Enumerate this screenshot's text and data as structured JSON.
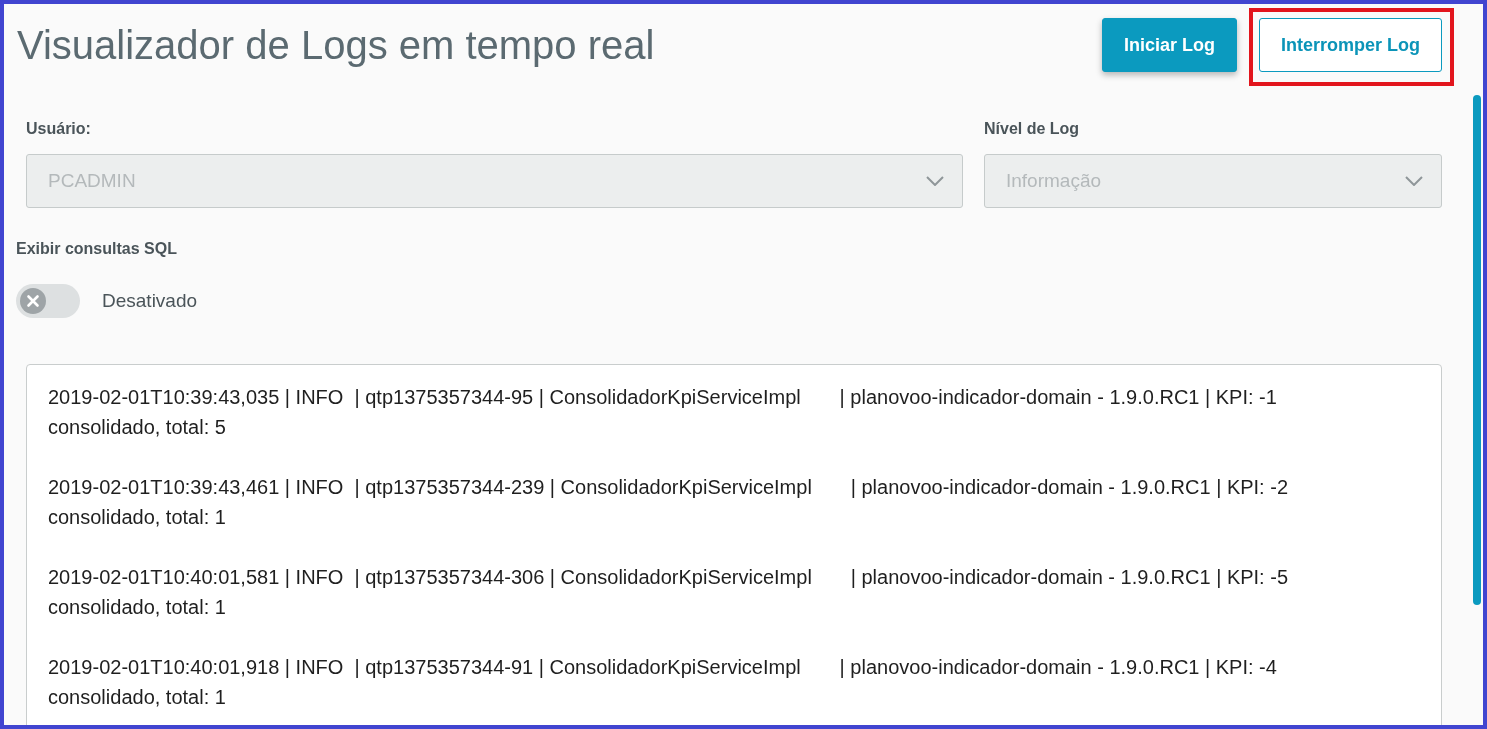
{
  "title": "Visualizador de Logs em tempo real",
  "buttons": [
    {
      "label": "Iniciar Log",
      "kind": "primary",
      "highlighted": false
    },
    {
      "label": "Interromper Log",
      "kind": "outline",
      "highlighted": true
    }
  ],
  "filters": [
    {
      "label": "Usuário:",
      "value": "PCADMIN",
      "disabled": true
    },
    {
      "label": "Nível de Log",
      "value": "Informação",
      "disabled": true
    }
  ],
  "sql_toggle": {
    "label": "Exibir consultas SQL",
    "on": false,
    "state_text": "Desativado"
  },
  "log_entries": [
    {
      "lines": [
        "2019-02-01T10:39:43,035 | INFO  | qtp1375357344-95 | ConsolidadorKpiServiceImpl       | planovoo-indicador-domain - 1.9.0.RC1 | KPI: -1",
        "consolidado, total: 5"
      ]
    },
    {
      "lines": [
        "2019-02-01T10:39:43,461 | INFO  | qtp1375357344-239 | ConsolidadorKpiServiceImpl       | planovoo-indicador-domain - 1.9.0.RC1 | KPI: -2",
        "consolidado, total: 1"
      ]
    },
    {
      "lines": [
        "2019-02-01T10:40:01,581 | INFO  | qtp1375357344-306 | ConsolidadorKpiServiceImpl       | planovoo-indicador-domain - 1.9.0.RC1 | KPI: -5",
        "consolidado, total: 1"
      ]
    },
    {
      "lines": [
        "2019-02-01T10:40:01,918 | INFO  | qtp1375357344-91 | ConsolidadorKpiServiceImpl       | planovoo-indicador-domain - 1.9.0.RC1 | KPI: -4",
        "consolidado, total: 1"
      ]
    }
  ]
}
